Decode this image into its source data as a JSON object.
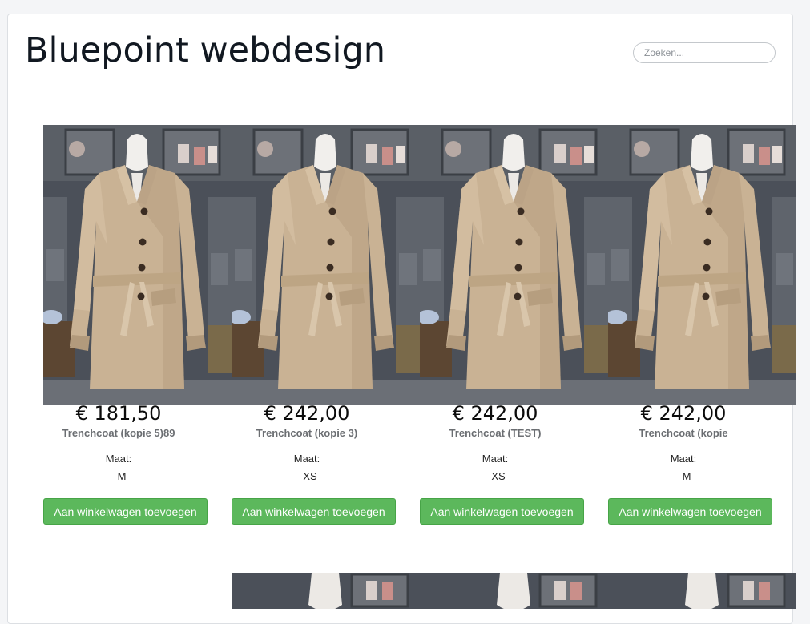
{
  "header": {
    "site_title": "Bluepoint webdesign",
    "search_placeholder": "Zoeken..."
  },
  "products": [
    {
      "price": "€ 181,50",
      "name": "Trenchcoat (kopie 5)89",
      "size_label": "Maat:",
      "size": "M",
      "button_label": "Aan winkelwagen toevoegen",
      "image": "beige trenchcoat on mannequin"
    },
    {
      "price": "€ 242,00",
      "name": "Trenchcoat (kopie 3)",
      "size_label": "Maat:",
      "size": "XS",
      "button_label": "Aan winkelwagen toevoegen",
      "image": "beige trenchcoat on mannequin"
    },
    {
      "price": "€ 242,00",
      "name": "Trenchcoat (TEST)",
      "size_label": "Maat:",
      "size": "XS",
      "button_label": "Aan winkelwagen toevoegen",
      "image": "beige trenchcoat on mannequin"
    },
    {
      "price": "€ 242,00",
      "name": "Trenchcoat (kopie",
      "size_label": "Maat:",
      "size": "M",
      "button_label": "Aan winkelwagen toevoegen",
      "image": "beige trenchcoat on mannequin"
    }
  ],
  "colors": {
    "button_green": "#5cb85c",
    "coat_beige": "#c9b294",
    "background_cabinet": "#4b5059"
  }
}
